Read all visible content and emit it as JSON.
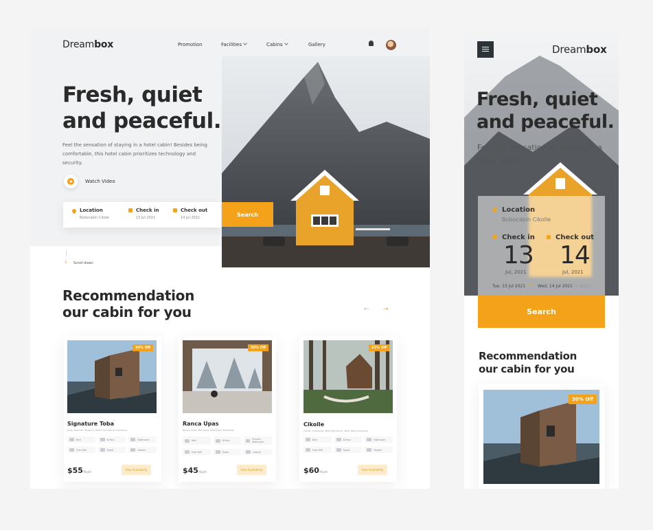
{
  "brand": {
    "name_regular": "Dream",
    "name_bold": "box",
    "accent": "#f3a21a"
  },
  "nav": {
    "items": [
      {
        "label": "Promotion"
      },
      {
        "label": "Facilities"
      },
      {
        "label": "Cabins"
      },
      {
        "label": "Gallery"
      }
    ]
  },
  "hero": {
    "title_line1": "Fresh, quiet",
    "title_line2": "and peaceful.",
    "subtitle": "Feel the sensation of staying in a hotel cabin! Besides being comfortable, this hotel cabin prioritizes technology and security.",
    "watch_video": "Watch Video",
    "scroll_down": "Scroll down"
  },
  "booking": {
    "location_label": "Location",
    "location_value": "Bobocabin Cikole",
    "checkin_label": "Check in",
    "checkin_value": "13 Jul 2021",
    "checkout_label": "Check out",
    "checkout_value": "14 Jul 2021",
    "search_label": "Search"
  },
  "recommendation": {
    "title_line1": "Recommendation",
    "title_line2": "our cabin for you",
    "cards": [
      {
        "badge": "30% Off",
        "name": "Signature Toba",
        "address": "Jalan Samosir Regency North Sumatera Indonesia",
        "facilities": [
          "Bed",
          "B-Pool",
          "Bathroom",
          "Free Wifi",
          "Towel",
          "Heater"
        ],
        "price": "$55",
        "per": "/Night",
        "cta": "View Availability"
      },
      {
        "badge": "30% Off",
        "name": "Ranca Upas",
        "address": "Ranca Upas, Bandung West Java Indonesia",
        "facilities": [
          "Bed",
          "B-Pool",
          "Shared Bathroom",
          "Free Wifi",
          "Towel",
          "Heater"
        ],
        "price": "$45",
        "per": "/Night",
        "cta": "View Availability"
      },
      {
        "badge": "25% Off",
        "name": "Cikolle",
        "address": "Cikole, Lembang, West Bandung, West Java Indonesia",
        "facilities": [
          "Bed",
          "B-Pool",
          "Bathroom",
          "Free Wifi",
          "Towel",
          "Heater"
        ],
        "price": "$60",
        "per": "/Night",
        "cta": "View Availability"
      }
    ]
  },
  "mobile": {
    "title_line1": "Fresh, quiet",
    "title_line2": "and peaceful.",
    "subtitle": "Feel the sensation of staying in a hotel cabin!",
    "location_label": "Location",
    "location_value": "Bobocabin Cikolle",
    "checkin_label": "Check in",
    "checkout_label": "Check out",
    "checkin_day": "13",
    "checkin_month": "Jul, 2021",
    "checkout_day": "14",
    "checkout_month": "Jul, 2021",
    "from_full": "Tue, 13 Jul 2021",
    "to_full": "Wed, 14 Jul 2021",
    "nights": "(1 Night)",
    "search_label": "Search",
    "rec_line1": "Recommendation",
    "rec_line2": "our cabin for you",
    "badge": "30% Off"
  }
}
